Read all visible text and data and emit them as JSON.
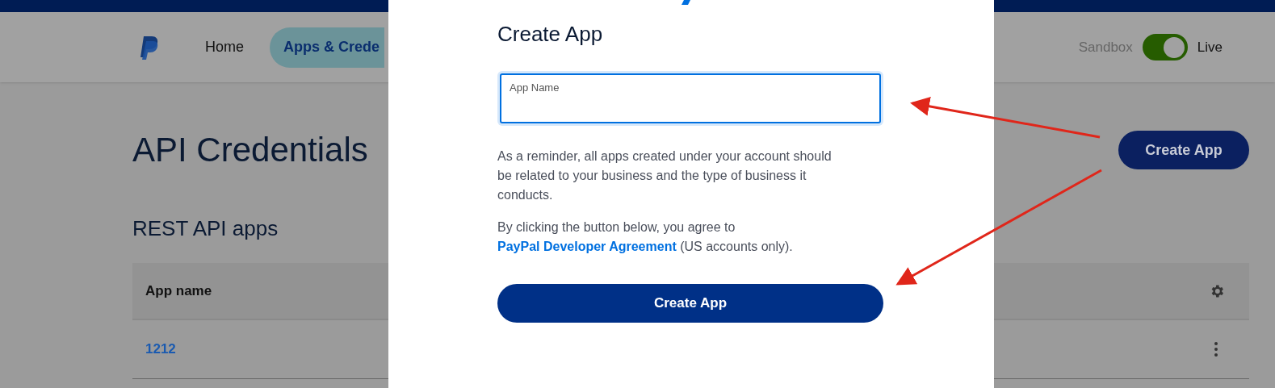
{
  "header": {
    "nav": [
      {
        "label": "Home",
        "selected": false
      },
      {
        "label": "Apps & Crede",
        "selected": true
      }
    ],
    "env_toggle": {
      "left_label": "Sandbox",
      "right_label": "Live",
      "on": true
    }
  },
  "page": {
    "title": "API Credentials",
    "create_button": "Create App",
    "section_title": "REST API apps",
    "table": {
      "columns": [
        "App name"
      ],
      "rows": [
        {
          "app_name": "1212"
        }
      ]
    }
  },
  "dialog": {
    "title": "Create App",
    "field": {
      "placeholder": "App Name"
    },
    "paragraph": "As a reminder, all apps created under your account should be related to your business and the type of business it conducts.",
    "agreement": {
      "before": "By clicking the button below, you agree to",
      "link": "PayPal Developer Agreement",
      "after": "(US accounts only)."
    },
    "submit": "Create App"
  }
}
